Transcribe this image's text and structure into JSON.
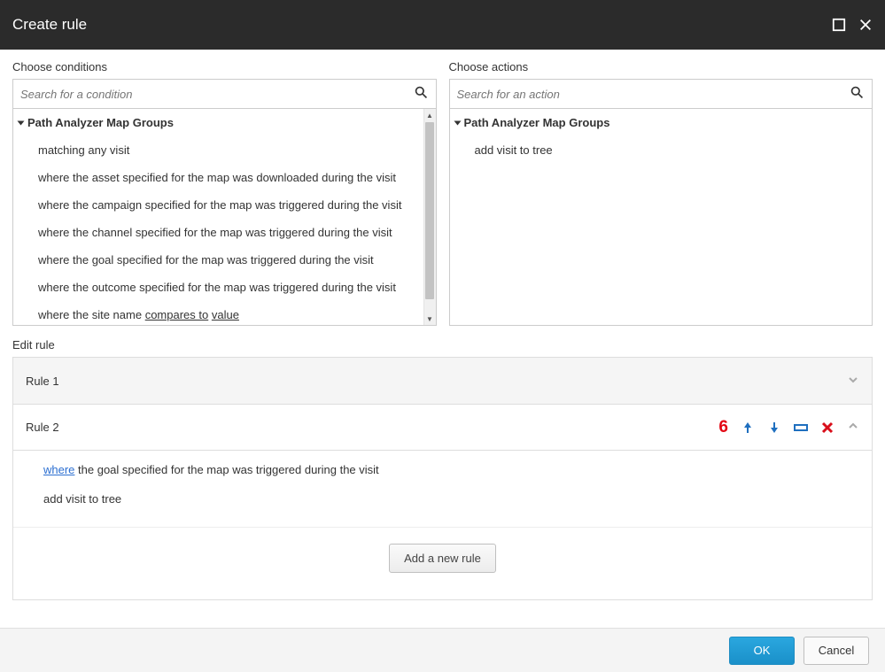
{
  "header": {
    "title": "Create rule"
  },
  "conditions": {
    "label": "Choose conditions",
    "placeholder": "Search for a condition",
    "group": "Path Analyzer Map Groups",
    "items": [
      "matching any visit",
      "where the asset specified for the map was downloaded during the visit",
      "where the campaign specified for the map was triggered during the visit",
      "where the channel specified for the map was triggered during the visit",
      "where the goal specified for the map was triggered during the visit",
      "where the outcome specified for the map was triggered during the visit"
    ],
    "last_item_prefix": "where the site name ",
    "last_item_token1": "compares to",
    "last_item_sep": " ",
    "last_item_token2": "value"
  },
  "actions": {
    "label": "Choose actions",
    "placeholder": "Search for an action",
    "group": "Path Analyzer Map Groups",
    "items": [
      "add visit to tree"
    ]
  },
  "edit": {
    "label": "Edit rule",
    "rule1": "Rule 1",
    "rule2": "Rule 2",
    "annotation": "6",
    "where": "where",
    "rule2_condition_rest": " the goal specified for the map was triggered during the visit",
    "rule2_action": "add visit to tree",
    "add_button": "Add a new rule"
  },
  "footer": {
    "ok": "OK",
    "cancel": "Cancel"
  }
}
